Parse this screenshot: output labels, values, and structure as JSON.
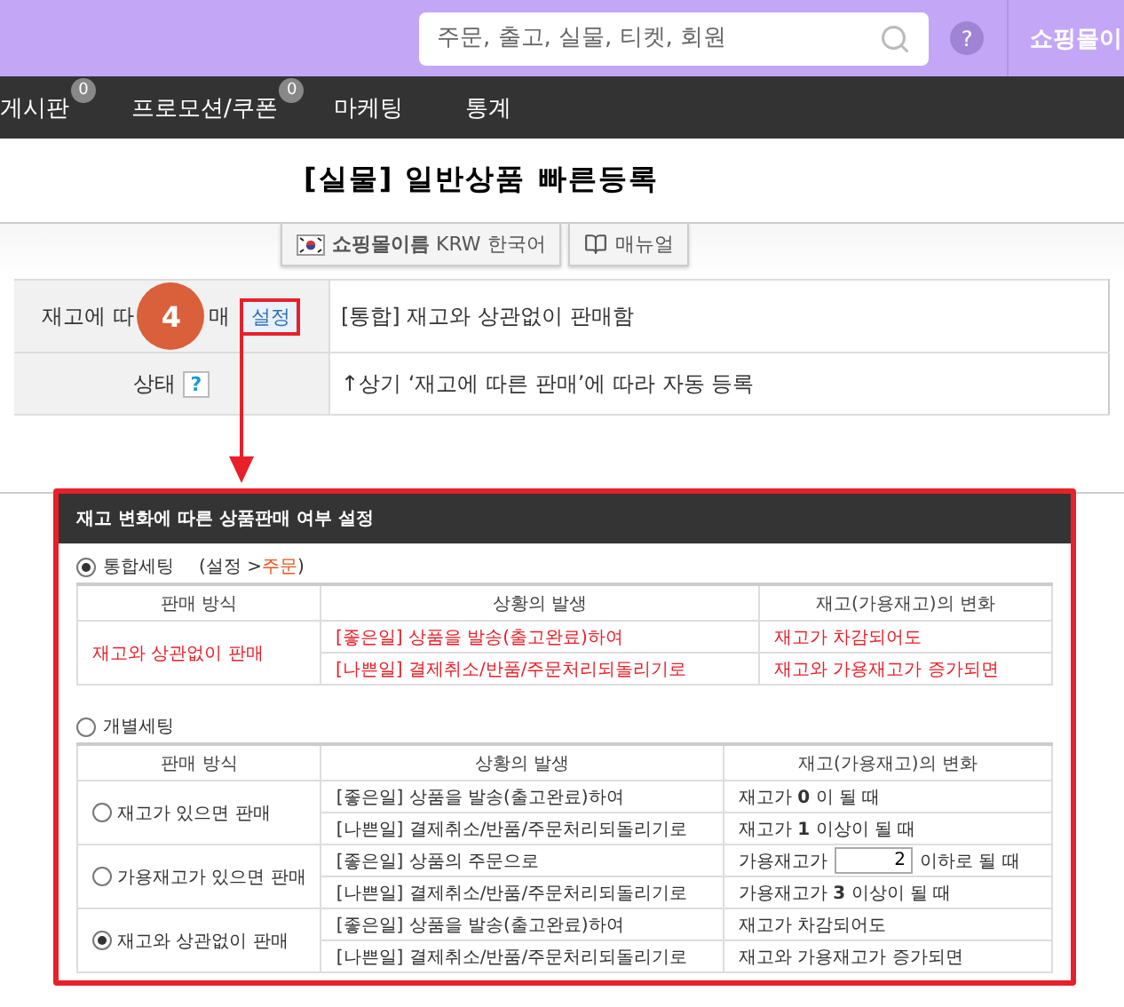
{
  "topbar": {
    "search": {
      "placeholder": "주문, 출고, 실물, 티켓, 회원"
    },
    "help": "?",
    "shop_name": "쇼핑몰이"
  },
  "nav": [
    {
      "label": "게시판",
      "badge": "0"
    },
    {
      "label": "프로모션/쿠폰",
      "badge": "0"
    },
    {
      "label": "마케팅"
    },
    {
      "label": "통계"
    }
  ],
  "page_title": "[실물] 일반상품 빠른등록",
  "tabs": [
    {
      "kind": "shop",
      "label": "**쇼핑몰이름** KRW 한국어"
    },
    {
      "kind": "manual",
      "label": "매뉴얼"
    }
  ],
  "form_rows": [
    {
      "label_parts": [
        "재고에 따",
        "매"
      ],
      "step": "4",
      "button": "설정",
      "value": "[통합] 재고와 상관없이 판매함"
    },
    {
      "label_parts": [
        "상태"
      ],
      "help": "?",
      "value": "↑상기 ‘재고에 따른 판매’에 따라 자동 등록"
    }
  ],
  "popup": {
    "title": "재고 변화에 따른 상품판매 여부 설정",
    "modes": [
      {
        "label": "통합세팅",
        "selected": true,
        "note": {
          "before": "(설정 >",
          "link": "주문",
          "after": ")"
        },
        "columns": [
          "판매 방식",
          "상황의 발생",
          "재고(가용재고)의 변화"
        ],
        "groups": [
          {
            "method": "재고와 상관없이 판매",
            "highlight": true,
            "events": [
              {
                "event": "[좋은일] 상품을 발송(출고완료)하여",
                "change": {
                  "kind": "text",
                  "text": "재고가 차감되어도"
                }
              },
              {
                "event": "[나쁜일] 결제취소/반품/주문처리되돌리기로",
                "change": {
                  "kind": "text",
                  "text": "재고와 가용재고가 증가되면"
                }
              }
            ]
          }
        ]
      },
      {
        "label": "개별세팅",
        "selected": false,
        "columns": [
          "판매 방식",
          "상황의 발생",
          "재고(가용재고)의 변화"
        ],
        "groups": [
          {
            "method": "재고가 있으면 판매",
            "highlight": false,
            "selected": false,
            "events": [
              {
                "event": "[좋은일] 상품을 발송(출고완료)하여",
                "change": {
                  "kind": "text",
                  "text": "재고가 **0** 이 될 때"
                }
              },
              {
                "event": "[나쁜일] 결제취소/반품/주문처리되돌리기로",
                "change": {
                  "kind": "text",
                  "text": "재고가 **1** 이상이 될 때"
                }
              }
            ]
          },
          {
            "method": "가용재고가 있으면 판매",
            "highlight": false,
            "selected": false,
            "events": [
              {
                "event": "[좋은일] 상품의 주문으로",
                "change": {
                  "kind": "input",
                  "before": "가용재고가",
                  "value": "2",
                  "after": "이하로 될 때"
                }
              },
              {
                "event": "[나쁜일] 결제취소/반품/주문처리되돌리기로",
                "change": {
                  "kind": "text",
                  "text": "가용재고가 **3** 이상이 될 때"
                }
              }
            ]
          },
          {
            "method": "재고와 상관없이 판매",
            "highlight": false,
            "selected": true,
            "events": [
              {
                "event": "[좋은일] 상품을 발송(출고완료)하여",
                "change": {
                  "kind": "text",
                  "text": "재고가 차감되어도"
                }
              },
              {
                "event": "[나쁜일] 결제취소/반품/주문처리되돌리기로",
                "change": {
                  "kind": "text",
                  "text": "재고와 가용재고가 증가되면"
                }
              }
            ]
          }
        ]
      }
    ]
  }
}
